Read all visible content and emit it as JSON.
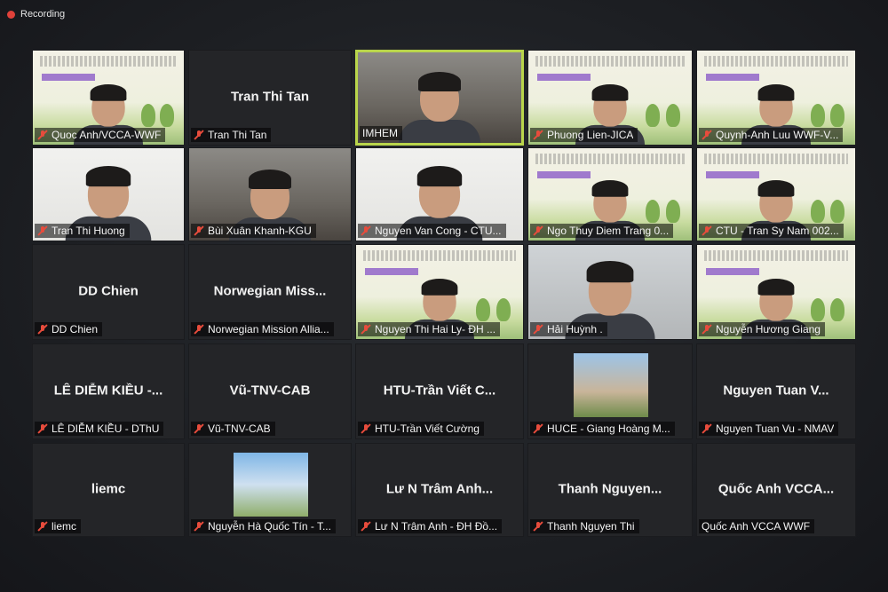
{
  "recording": {
    "label": "Recording"
  },
  "colors": {
    "active_border": "#b9d54b",
    "mic_muted": "#e74c3c",
    "tile_bg": "#242528"
  },
  "tiles": [
    {
      "label": "Quoc Anh/VCCA-WWF",
      "muted": true,
      "kind": "video-slide"
    },
    {
      "name": "Tran Thi Tan",
      "label": "Tran Thi Tan",
      "muted": true,
      "kind": "name"
    },
    {
      "label": "IMHEM",
      "muted": false,
      "kind": "video-room",
      "active": true
    },
    {
      "label": "Phuong Lien-JICA",
      "muted": true,
      "kind": "video-slide"
    },
    {
      "label": "Quynh-Anh Luu WWF-V...",
      "muted": true,
      "kind": "video-slide"
    },
    {
      "label": "Tran Thi Huong",
      "muted": true,
      "kind": "video-white"
    },
    {
      "label": "Bùi Xuân Khanh-KGU",
      "muted": true,
      "kind": "video-room"
    },
    {
      "label": "Nguyen Van Cong - CTU...",
      "muted": true,
      "kind": "video-white"
    },
    {
      "label": "Ngo Thuy Diem Trang 0...",
      "muted": true,
      "kind": "video-slide"
    },
    {
      "label": "CTU - Tran Sy Nam 002...",
      "muted": true,
      "kind": "video-slide"
    },
    {
      "name": "DD Chien",
      "label": "DD Chien",
      "muted": true,
      "kind": "name"
    },
    {
      "name": "Norwegian  Miss...",
      "label": "Norwegian Mission Allia...",
      "muted": true,
      "kind": "name"
    },
    {
      "label": "Nguyen Thi Hai Ly- ĐH ...",
      "muted": true,
      "kind": "video-slide"
    },
    {
      "label": "Hải Huỳnh .",
      "muted": true,
      "kind": "video-photo"
    },
    {
      "label": "Nguyễn Hương Giang",
      "muted": true,
      "kind": "video-slide"
    },
    {
      "name": "LÊ DIỄM KIỀU -...",
      "label": "LÊ DIỄM KIỀU - DThU",
      "muted": true,
      "kind": "name"
    },
    {
      "name": "Vũ-TNV-CAB",
      "label": "Vũ-TNV-CAB",
      "muted": true,
      "kind": "name"
    },
    {
      "name": "HTU-Trần Viết C...",
      "label": "HTU-Trần Viết Cường",
      "muted": true,
      "kind": "name"
    },
    {
      "label": "HUCE - Giang Hoàng M...",
      "muted": true,
      "kind": "avatar"
    },
    {
      "name": "Nguyen Tuan V...",
      "label": "Nguyen Tuan Vu - NMAV",
      "muted": true,
      "kind": "name"
    },
    {
      "name": "liemc",
      "label": "liemc",
      "muted": true,
      "kind": "name"
    },
    {
      "label": "Nguyễn Hà Quốc Tín - T...",
      "muted": true,
      "kind": "avatar-flower"
    },
    {
      "name": "Lư N Trâm Anh...",
      "label": "Lư N Trâm Anh - ĐH Đồ...",
      "muted": true,
      "kind": "name"
    },
    {
      "name": "Thanh  Nguyen...",
      "label": "Thanh Nguyen Thi",
      "muted": true,
      "kind": "name"
    },
    {
      "name": "Quốc Anh VCCA...",
      "label": "Quốc Anh VCCA WWF",
      "muted": false,
      "kind": "name"
    }
  ]
}
